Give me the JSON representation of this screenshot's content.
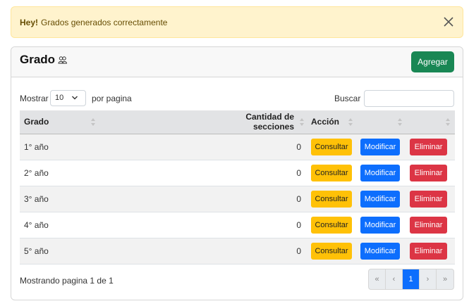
{
  "alert": {
    "strong": "Hey!",
    "message": "Grados generados correctamente"
  },
  "card": {
    "title": "Grado",
    "add_button": "Agregar"
  },
  "controls": {
    "show_label": "Mostrar",
    "page_length": "10",
    "per_page_label": "por pagina",
    "search_label": "Buscar",
    "search_value": ""
  },
  "table": {
    "columns": [
      "Grado",
      "Cantidad de secciones",
      "Acción",
      "",
      ""
    ],
    "rows": [
      {
        "grado": "1° año",
        "secciones": "0"
      },
      {
        "grado": "2° año",
        "secciones": "0"
      },
      {
        "grado": "3° año",
        "secciones": "0"
      },
      {
        "grado": "4° año",
        "secciones": "0"
      },
      {
        "grado": "5° año",
        "secciones": "0"
      }
    ],
    "actions": {
      "consult": "Consultar",
      "modify": "Modificar",
      "delete": "Eliminar"
    }
  },
  "footer": {
    "info": "Mostrando pagina 1 de 1",
    "pager": {
      "first": "«",
      "prev": "‹",
      "current": "1",
      "next": "›",
      "last": "»"
    }
  },
  "colors": {
    "alert_bg": "#fff3cd",
    "success": "#198754",
    "warning": "#ffc107",
    "primary": "#0d6efd",
    "danger": "#dc3545"
  }
}
